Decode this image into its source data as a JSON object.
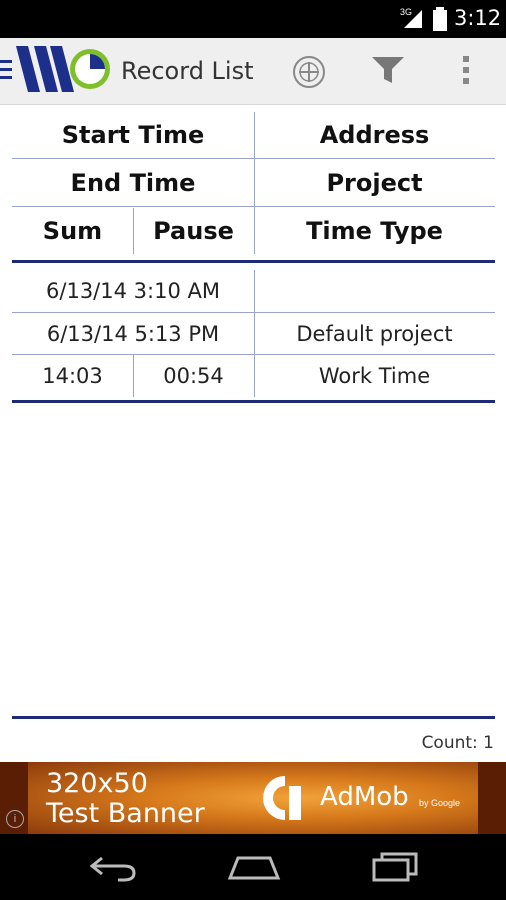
{
  "status_bar": {
    "network": "3G",
    "time": "3:12"
  },
  "action_bar": {
    "title": "Record List",
    "icons": [
      "up-menu-icon",
      "app-logo-icon",
      "add-icon",
      "filter-icon",
      "overflow-menu-icon"
    ]
  },
  "table": {
    "header": {
      "row1": [
        "Start Time",
        "Address"
      ],
      "row2": [
        "End Time",
        "Project"
      ],
      "row3": [
        "Sum",
        "Pause",
        "Time Type"
      ]
    },
    "record": {
      "start_time": "6/13/14 3:10 AM",
      "address": "",
      "end_time": "6/13/14 5:13 PM",
      "project": "Default project",
      "sum": "14:03",
      "pause": "00:54",
      "time_type": "Work Time"
    }
  },
  "footer": {
    "count": "Count: 1"
  },
  "ad": {
    "line1": "320x50",
    "line2": "Test Banner",
    "brand": "AdMob",
    "by": "by Google"
  },
  "colors": {
    "accent": "#1c2a78",
    "grid": "#9aa3c8",
    "ad": "#d6791b"
  }
}
